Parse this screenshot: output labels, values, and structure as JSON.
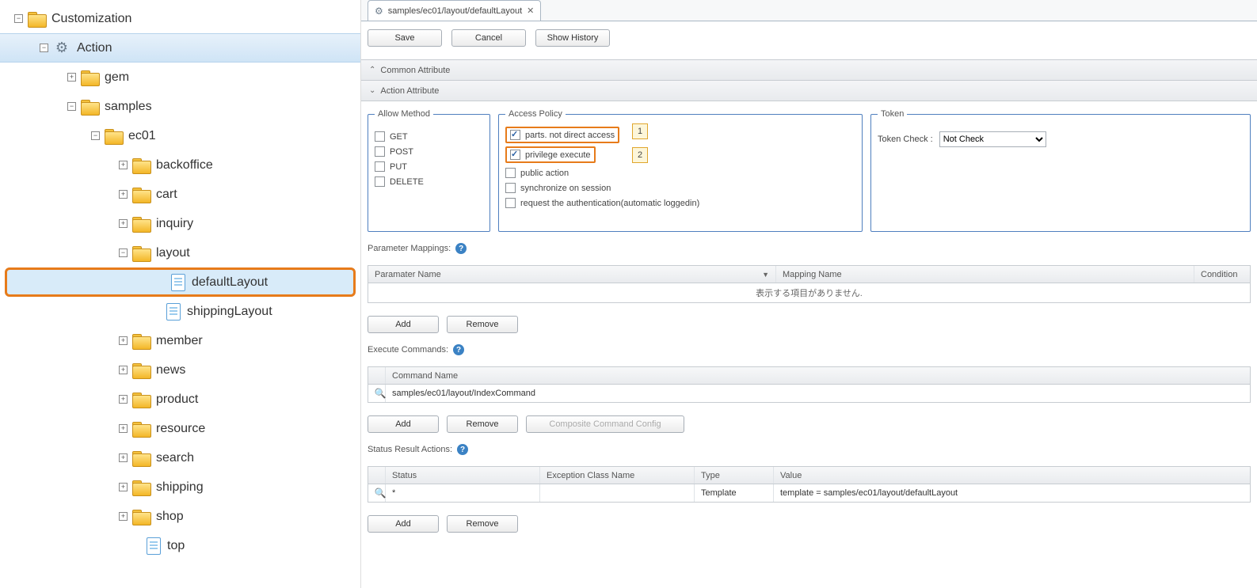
{
  "tree": {
    "root": "Customization",
    "action": "Action",
    "gem": "gem",
    "samples": "samples",
    "ec01": "ec01",
    "backoffice": "backoffice",
    "cart": "cart",
    "inquiry": "inquiry",
    "layout": "layout",
    "defaultLayout": "defaultLayout",
    "shippingLayout": "shippingLayout",
    "member": "member",
    "news": "news",
    "product": "product",
    "resource": "resource",
    "search": "search",
    "shipping": "shipping",
    "shop": "shop",
    "top": "top"
  },
  "tab": {
    "label": "samples/ec01/layout/defaultLayout"
  },
  "toolbar": {
    "save": "Save",
    "cancel": "Cancel",
    "history": "Show History"
  },
  "sections": {
    "common": "Common Attribute",
    "action": "Action Attribute"
  },
  "allowMethod": {
    "legend": "Allow Method",
    "get": "GET",
    "post": "POST",
    "put": "PUT",
    "delete": "DELETE"
  },
  "accessPolicy": {
    "legend": "Access Policy",
    "parts": "parts. not direct access",
    "priv": "privilege execute",
    "public": "public action",
    "sync": "synchronize on session",
    "auth": "request the authentication(automatic loggedin)"
  },
  "callouts": {
    "one": "1",
    "two": "2"
  },
  "token": {
    "legend": "Token",
    "label": "Token Check :",
    "value": "Not Check"
  },
  "paramMap": {
    "title": "Parameter Mappings:",
    "col1": "Paramater Name",
    "col2": "Mapping Name",
    "col3": "Condition",
    "empty": "表示する項目がありません."
  },
  "exec": {
    "title": "Execute Commands:",
    "col": "Command Name",
    "row1": "samples/ec01/layout/IndexCommand",
    "composite": "Composite Command Config"
  },
  "status": {
    "title": "Status Result Actions:",
    "col1": "Status",
    "col2": "Exception Class Name",
    "col3": "Type",
    "col4": "Value",
    "r_status": "*",
    "r_type": "Template",
    "r_value": "template = samples/ec01/layout/defaultLayout"
  },
  "buttons": {
    "add": "Add",
    "remove": "Remove"
  }
}
